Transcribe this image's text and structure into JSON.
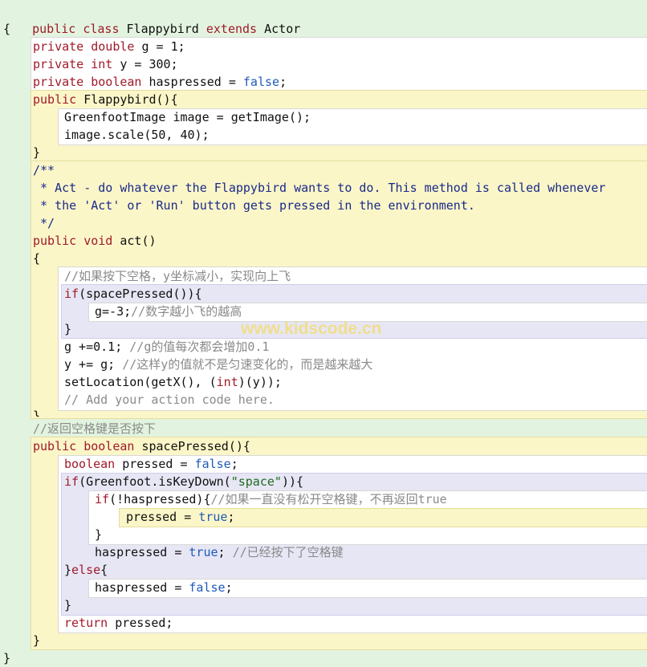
{
  "editor": {
    "class_decl": {
      "kw1": "public",
      "kw2": "class",
      "name": " Flappybird ",
      "kw3": "extends",
      "parent": " Actor"
    },
    "open_brace": "{",
    "close_brace": "}",
    "fields": [
      {
        "kw1": "private",
        "kw2": "double",
        "rest": " g = 1;"
      },
      {
        "kw1": "private",
        "kw2": "int",
        "rest": " y = 300;"
      },
      {
        "kw1": "private",
        "kw2": "boolean",
        "rest": " haspressed = ",
        "lit": "false",
        "end": ";"
      }
    ],
    "constructor": {
      "kw": "public",
      "sig": " Flappybird(){",
      "line1": "GreenfootImage image = getImage();",
      "line2": "image.scale(50, 40);",
      "close": "}"
    },
    "javadoc": [
      "/**",
      " * Act - do whatever the Flappybird wants to do. This method is called whenever",
      " * the 'Act' or 'Run' button gets pressed in the environment.",
      " */"
    ],
    "act": {
      "kw1": "public",
      "kw2": "void",
      "sig": " act()",
      "open": "{",
      "comment1": "//如果按下空格，y坐标减小，实现向上飞",
      "if_kw": "if",
      "if_rest": "(spacePressed()){",
      "g_assign": "g=-3;",
      "comment2": "//数字越小飞的越高",
      "if_close": "}",
      "g_inc": "g +=0.1; ",
      "comment3": "//g的值每次都会增加0.1",
      "y_inc": "y += g; ",
      "comment4": "//这样y的值就不是匀速变化的，而是越来越大",
      "setloc_a": "setLocation(getX(), (",
      "setloc_kw": "int",
      "setloc_b": ")(y));",
      "comment5": "// Add your action code here.",
      "close": "}"
    },
    "comment_return": "//返回空格键是否按下",
    "sp": {
      "kw1": "public",
      "kw2": "boolean",
      "sig": " spacePressed(){",
      "decl_kw": "boolean",
      "decl_rest": " pressed = ",
      "decl_lit": "false",
      "decl_end": ";",
      "if1_kw": "if",
      "if1_a": "(Greenfoot.isKeyDown(",
      "if1_str": "\"space\"",
      "if1_b": ")){",
      "if2_kw": "if",
      "if2_rest": "(!haspressed){",
      "comment_if2": "//如果一直没有松开空格键，不再返回true",
      "assign_a": "pressed = ",
      "assign_lit": "true",
      "assign_end": ";",
      "inner_close": "}",
      "hp_a": "haspressed = ",
      "hp_lit": "true",
      "hp_end": "; ",
      "comment_hp": "//已经按下了空格键",
      "else_a": "}",
      "else_kw": "else",
      "else_b": "{",
      "hp2_a": "haspressed = ",
      "hp2_lit": "false",
      "hp2_end": ";",
      "if1_close": "}",
      "ret_kw": "return",
      "ret_rest": " pressed;",
      "close": "}"
    }
  },
  "watermark": "www.kidscode.cn"
}
